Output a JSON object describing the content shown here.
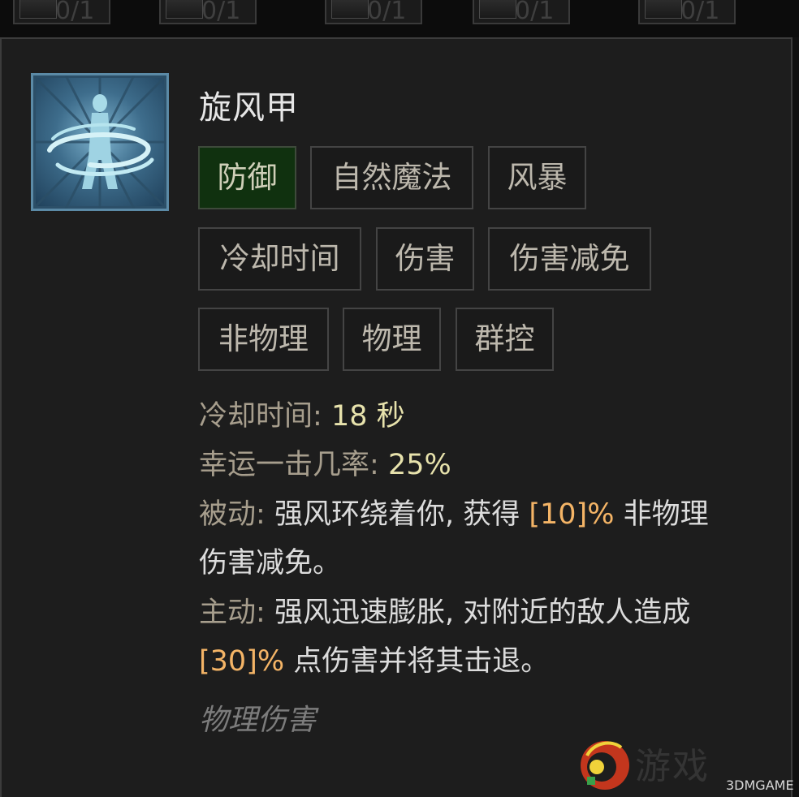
{
  "top_slots": [
    {
      "count": "0/1"
    },
    {
      "count": "0/1"
    },
    {
      "count": "0/1"
    },
    {
      "count": "0/1"
    },
    {
      "count": "0/1"
    }
  ],
  "skill": {
    "name": "旋风甲",
    "icon": "whirlwind-armor-icon",
    "tags": [
      "防御",
      "自然魔法",
      "风暴",
      "冷却时间",
      "伤害",
      "伤害减免",
      "非物理",
      "物理",
      "群控"
    ],
    "active_tag": "防御",
    "cooldown_label": "冷却时间:",
    "cooldown_value": "18 秒",
    "lucky_label": "幸运一击几率:",
    "lucky_value": "25%",
    "passive_label": "被动:",
    "passive_text_a": "强风环绕着你, 获得",
    "passive_value": "[10]%",
    "passive_text_b": "非物理",
    "passive_text_c": "伤害减免。",
    "active_label": "主动:",
    "active_text_a": "强风迅速膨胀, 对附近的敌人造成",
    "active_value": "[30]%",
    "active_text_b": "点伤害并将其击退。",
    "damage_type": "物理伤害"
  },
  "watermark": {
    "site_text": "游戏",
    "brand": "3DMGAME"
  },
  "colors": {
    "panel_bg": "#1d1d1d",
    "active_tag_bg": "#10310f",
    "label": "#a79e8d",
    "value": "#e7e2ac",
    "highlight": "#f4b466"
  }
}
